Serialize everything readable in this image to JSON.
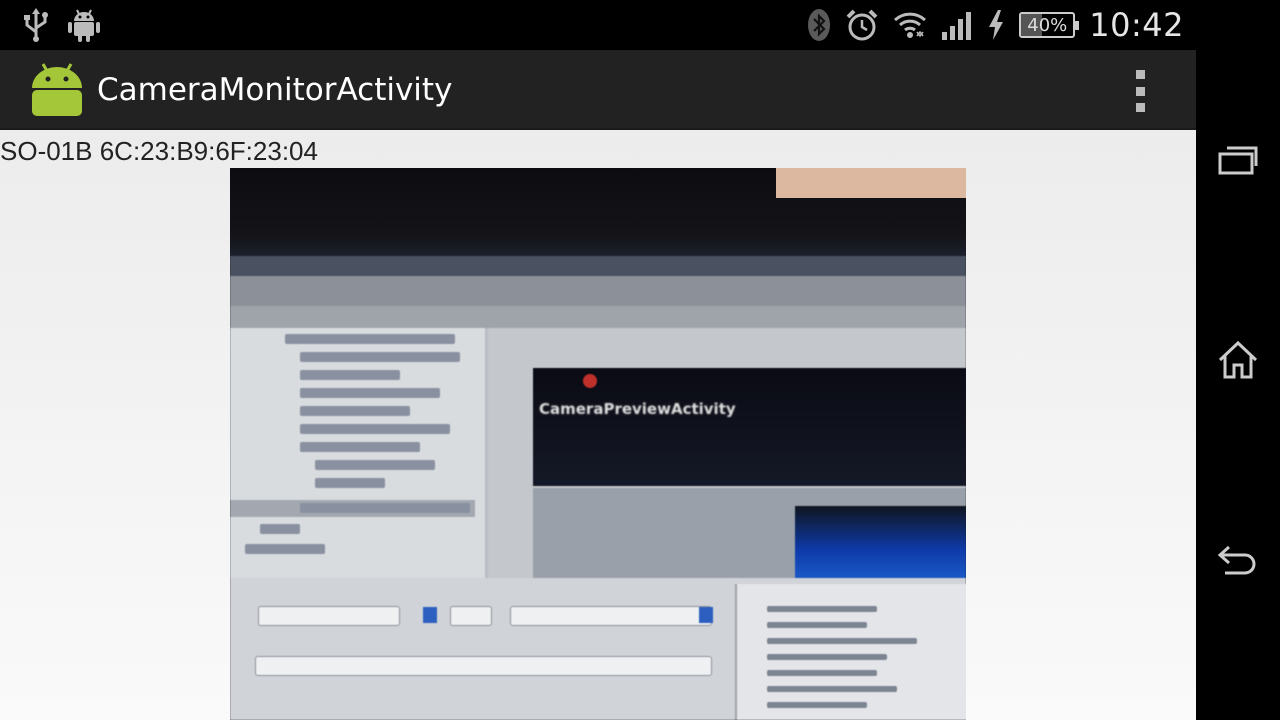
{
  "status_bar": {
    "left_icons": [
      "usb-icon",
      "android-debug-icon"
    ],
    "right_icons": [
      "bluetooth-icon",
      "alarm-icon",
      "wifi-icon",
      "signal-icon",
      "charging-icon"
    ],
    "battery_percent": "40%",
    "battery_level": 0.4,
    "time": "10:42"
  },
  "action_bar": {
    "app_icon": "android-app-icon",
    "title": "CameraMonitorActivity",
    "overflow_icon": "overflow-menu-icon"
  },
  "content": {
    "device_label": "SO-01B 6C:23:B9:6F:23:04",
    "preview": {
      "caption": "CameraPreviewActivity"
    }
  },
  "nav_bar": {
    "buttons": [
      "recent-apps-icon",
      "home-icon",
      "back-icon"
    ]
  },
  "colors": {
    "status_bar_bg": "#000000",
    "action_bar_bg": "#222222",
    "content_bg": "#f2f2f2",
    "android_green": "#a4c639"
  }
}
